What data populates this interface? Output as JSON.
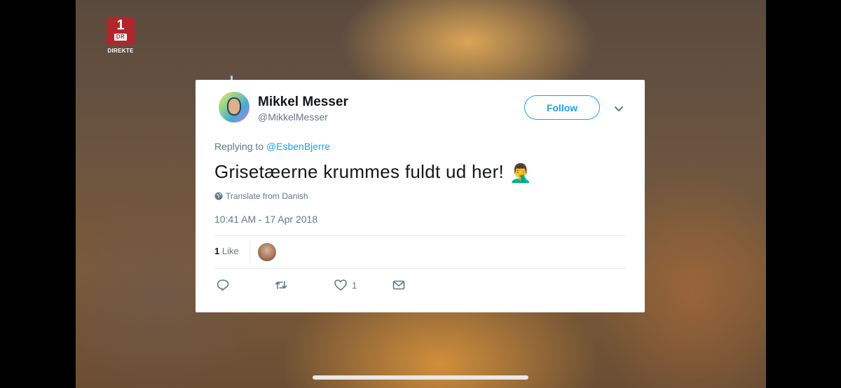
{
  "channel": {
    "number": "1",
    "brand": "DR",
    "live_label": "DIREKTE"
  },
  "tweet": {
    "author_name": "Mikkel Messer",
    "author_handle": "@MikkelMesser",
    "follow_label": "Follow",
    "reply_prefix": "Replying to",
    "reply_to_handle": "@EsbenBjerre",
    "text": "Grisetæerne krummes fuldt ud her!",
    "emoji": "🤦‍♂️",
    "translate_label": "Translate from Danish",
    "timestamp": "10:41 AM - 17 Apr 2018",
    "like_count": "1",
    "like_word": "Like",
    "action_like_count": "1"
  },
  "icons": {
    "caret": "chevron-down-icon",
    "translate": "globe-icon",
    "reply": "reply-icon",
    "retweet": "retweet-icon",
    "like": "heart-icon",
    "message": "envelope-icon"
  },
  "colors": {
    "accent": "#1da1f2",
    "muted": "#657786",
    "text": "#14171a",
    "dr_red": "#b0262b"
  }
}
